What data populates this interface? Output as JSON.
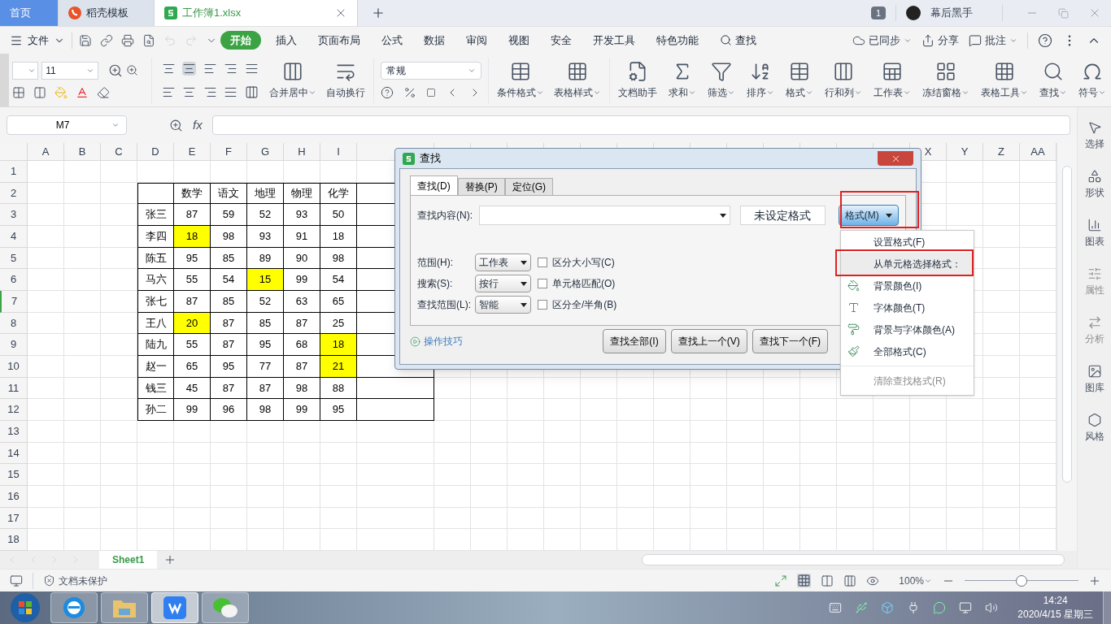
{
  "tabs": [
    {
      "label": "首页",
      "kind": "home",
      "selected": false
    },
    {
      "label": "稻壳模板",
      "kind": "template",
      "selected": false
    },
    {
      "label": "工作簿1.xlsx",
      "kind": "sheet",
      "selected": true
    }
  ],
  "title_bar": {
    "window_count": "1",
    "user": "幕后黑手"
  },
  "menu": {
    "file": "文件",
    "ribbon_tabs": [
      {
        "label": "开始",
        "selected": true
      },
      {
        "label": "插入",
        "selected": false
      },
      {
        "label": "页面布局",
        "selected": false
      },
      {
        "label": "公式",
        "selected": false
      },
      {
        "label": "数据",
        "selected": false
      },
      {
        "label": "审阅",
        "selected": false
      },
      {
        "label": "视图",
        "selected": false
      },
      {
        "label": "安全",
        "selected": false
      },
      {
        "label": "开发工具",
        "selected": false
      },
      {
        "label": "特色功能",
        "selected": false
      }
    ],
    "search": "查找",
    "sync": "已同步",
    "share": "分享",
    "comment": "批注"
  },
  "toolbar": {
    "font_size": "11",
    "number_format": "常规",
    "align_buttons": [
      {
        "label": "合并居中",
        "dropdown": true
      },
      {
        "label": "自动换行",
        "dropdown": false
      }
    ],
    "style_buttons": [
      {
        "label": "条件格式",
        "dropdown": true
      },
      {
        "label": "表格样式",
        "dropdown": true
      }
    ],
    "tool_buttons": [
      {
        "label": "文档助手",
        "dropdown": false
      },
      {
        "label": "求和",
        "dropdown": true
      },
      {
        "label": "筛选",
        "dropdown": true
      },
      {
        "label": "排序",
        "dropdown": true
      },
      {
        "label": "格式",
        "dropdown": true
      },
      {
        "label": "行和列",
        "dropdown": true
      },
      {
        "label": "工作表",
        "dropdown": true
      },
      {
        "label": "冻结窗格",
        "dropdown": true
      },
      {
        "label": "表格工具",
        "dropdown": true
      },
      {
        "label": "查找",
        "dropdown": true
      },
      {
        "label": "符号",
        "dropdown": true
      }
    ]
  },
  "formula_bar": {
    "name_box": "M7",
    "fx": "fx"
  },
  "sheet": {
    "columns": [
      "A",
      "B",
      "C",
      "D",
      "E",
      "F",
      "G",
      "H",
      "I"
    ],
    "right_columns": [
      "X",
      "Y",
      "Z",
      "AA"
    ],
    "rows": [
      {
        "number": "1",
        "selected": false
      },
      {
        "number": "2",
        "selected": false,
        "cells": [
          {
            "highlighted": false
          },
          {
            "text": "数学",
            "highlighted": false
          },
          {
            "text": "语文",
            "highlighted": false
          },
          {
            "text": "地理",
            "highlighted": false
          },
          {
            "text": "物理",
            "highlighted": false
          },
          {
            "text": "化学",
            "highlighted": false
          },
          {
            "highlighted": false
          }
        ]
      },
      {
        "number": "3",
        "selected": false,
        "cells": [
          {
            "text": "张三",
            "highlighted": false
          },
          {
            "text": "87",
            "highlighted": false
          },
          {
            "text": "59",
            "highlighted": false
          },
          {
            "text": "52",
            "highlighted": false
          },
          {
            "text": "93",
            "highlighted": false
          },
          {
            "text": "50",
            "highlighted": false
          },
          {
            "highlighted": false
          }
        ]
      },
      {
        "number": "4",
        "selected": false,
        "cells": [
          {
            "text": "李四",
            "highlighted": false
          },
          {
            "text": "18",
            "highlighted": true
          },
          {
            "text": "98",
            "highlighted": false
          },
          {
            "text": "93",
            "highlighted": false
          },
          {
            "text": "91",
            "highlighted": false
          },
          {
            "text": "18",
            "highlighted": false
          },
          {
            "highlighted": false
          }
        ]
      },
      {
        "number": "5",
        "selected": false,
        "cells": [
          {
            "text": "陈五",
            "highlighted": false
          },
          {
            "text": "95",
            "highlighted": false
          },
          {
            "text": "85",
            "highlighted": false
          },
          {
            "text": "89",
            "highlighted": false
          },
          {
            "text": "90",
            "highlighted": false
          },
          {
            "text": "98",
            "highlighted": false
          },
          {
            "highlighted": false
          }
        ]
      },
      {
        "number": "6",
        "selected": false,
        "cells": [
          {
            "text": "马六",
            "highlighted": false
          },
          {
            "text": "55",
            "highlighted": false
          },
          {
            "text": "54",
            "highlighted": false
          },
          {
            "text": "15",
            "highlighted": true
          },
          {
            "text": "99",
            "highlighted": false
          },
          {
            "text": "54",
            "highlighted": false
          },
          {
            "highlighted": false
          }
        ]
      },
      {
        "number": "7",
        "selected": true,
        "cells": [
          {
            "text": "张七",
            "highlighted": false
          },
          {
            "text": "87",
            "highlighted": false
          },
          {
            "text": "85",
            "highlighted": false
          },
          {
            "text": "52",
            "highlighted": false
          },
          {
            "text": "63",
            "highlighted": false
          },
          {
            "text": "65",
            "highlighted": false
          },
          {
            "highlighted": false
          }
        ]
      },
      {
        "number": "8",
        "selected": false,
        "cells": [
          {
            "text": "王八",
            "highlighted": false
          },
          {
            "text": "20",
            "highlighted": true
          },
          {
            "text": "87",
            "highlighted": false
          },
          {
            "text": "85",
            "highlighted": false
          },
          {
            "text": "87",
            "highlighted": false
          },
          {
            "text": "25",
            "highlighted": false
          },
          {
            "highlighted": false
          }
        ]
      },
      {
        "number": "9",
        "selected": false,
        "cells": [
          {
            "text": "陆九",
            "highlighted": false
          },
          {
            "text": "55",
            "highlighted": false
          },
          {
            "text": "87",
            "highlighted": false
          },
          {
            "text": "95",
            "highlighted": false
          },
          {
            "text": "68",
            "highlighted": false
          },
          {
            "text": "18",
            "highlighted": true
          },
          {
            "highlighted": false
          }
        ]
      },
      {
        "number": "10",
        "selected": false,
        "cells": [
          {
            "text": "赵一",
            "highlighted": false
          },
          {
            "text": "65",
            "highlighted": false
          },
          {
            "text": "95",
            "highlighted": false
          },
          {
            "text": "77",
            "highlighted": false
          },
          {
            "text": "87",
            "highlighted": false
          },
          {
            "text": "21",
            "highlighted": true
          },
          {
            "highlighted": false
          }
        ]
      },
      {
        "number": "11",
        "selected": false,
        "cells": [
          {
            "text": "钱三",
            "highlighted": false
          },
          {
            "text": "45",
            "highlighted": false
          },
          {
            "text": "87",
            "highlighted": false
          },
          {
            "text": "87",
            "highlighted": false
          },
          {
            "text": "98",
            "highlighted": false
          },
          {
            "text": "88",
            "highlighted": false
          },
          {
            "highlighted": false
          }
        ]
      },
      {
        "number": "12",
        "selected": false,
        "cells": [
          {
            "text": "孙二",
            "highlighted": false
          },
          {
            "text": "99",
            "highlighted": false
          },
          {
            "text": "96",
            "highlighted": false
          },
          {
            "text": "98",
            "highlighted": false
          },
          {
            "text": "99",
            "highlighted": false
          },
          {
            "text": "95",
            "highlighted": false
          },
          {
            "highlighted": false
          }
        ]
      },
      {
        "number": "13",
        "selected": false
      },
      {
        "number": "14",
        "selected": false
      },
      {
        "number": "15",
        "selected": false
      },
      {
        "number": "16",
        "selected": false
      },
      {
        "number": "17",
        "selected": false
      },
      {
        "number": "18",
        "selected": false
      }
    ]
  },
  "dialog": {
    "title": "查找",
    "tabs": [
      {
        "label": "查找(D)",
        "selected": true
      },
      {
        "label": "替换(P)",
        "selected": false
      },
      {
        "label": "定位(G)",
        "selected": false
      }
    ],
    "find_label": "查找内容(N):",
    "format_status": "未设定格式",
    "format_button": "格式(M)",
    "options": [
      {
        "label": "范围(H):",
        "value": "工作表",
        "checkbox": "区分大小写(C)",
        "checked": false
      },
      {
        "label": "搜索(S):",
        "value": "按行",
        "checkbox": "单元格匹配(O)",
        "checked": false
      },
      {
        "label": "查找范围(L):",
        "value": "智能",
        "checkbox": "区分全/半角(B)",
        "checked": false
      }
    ],
    "tips_link": "操作技巧",
    "buttons": [
      "查找全部(I)",
      "查找上一个(V)",
      "查找下一个(F)"
    ]
  },
  "format_menu": [
    {
      "label": "设置格式(F)",
      "selected": false,
      "disabled": false
    },
    {
      "label": "从单元格选择格式：",
      "selected": true,
      "disabled": false
    },
    {
      "label": "背景颜色(I)",
      "selected": false,
      "disabled": false
    },
    {
      "label": "字体颜色(T)",
      "selected": false,
      "disabled": false
    },
    {
      "label": "背景与字体颜色(A)",
      "selected": false,
      "disabled": false
    },
    {
      "label": "全部格式(C)",
      "selected": false,
      "disabled": false
    },
    {
      "label": "清除查找格式(R)",
      "selected": false,
      "disabled": true
    }
  ],
  "sidebar": [
    {
      "label": "选择",
      "disabled": false
    },
    {
      "label": "形状",
      "disabled": false
    },
    {
      "label": "图表",
      "disabled": false
    },
    {
      "label": "属性",
      "disabled": true
    },
    {
      "label": "分析",
      "disabled": true
    },
    {
      "label": "图库",
      "disabled": false
    },
    {
      "label": "风格",
      "disabled": false
    }
  ],
  "sheet_tabs": [
    {
      "label": "Sheet1",
      "selected": true
    }
  ],
  "status_bar": {
    "protection": "文档未保护",
    "zoom": "100%",
    "zoom_slider": {
      "level": 0.5
    }
  },
  "taskbar": {
    "apps": [
      {
        "kind": "browser",
        "selected": false
      },
      {
        "kind": "folder",
        "selected": false
      },
      {
        "kind": "office",
        "selected": true
      },
      {
        "kind": "chat",
        "selected": false
      }
    ],
    "time": "14:24",
    "date": "2020/4/15 星期三"
  }
}
